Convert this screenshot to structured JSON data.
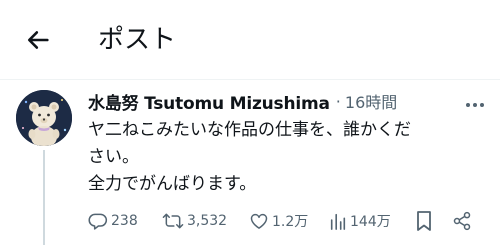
{
  "header": {
    "title": "ポスト",
    "back_icon": "arrow-left-icon"
  },
  "tweet": {
    "author_name": "水島努 Tsutomu Mizushima",
    "separator": "·",
    "time_ago": "16時間",
    "text_lines": [
      "ヤ二ねこみたいな作品の仕事を、誰かくだ",
      "さい。",
      "全力でがんばります。"
    ],
    "stats": {
      "replies": "238",
      "reposts": "3,532",
      "likes": "1.2万",
      "views": "144万"
    }
  },
  "colors": {
    "text": "#0f1419",
    "secondary": "#536471",
    "divider": "#eff3f4",
    "thread": "#cfd9de"
  }
}
